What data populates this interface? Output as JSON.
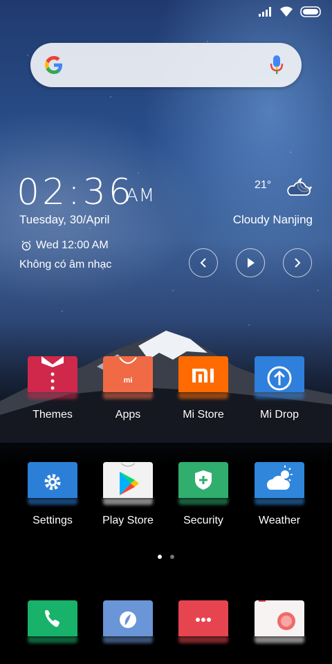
{
  "clock": {
    "time": "02:36",
    "ampm": "AM",
    "date": "Tuesday, 30/April"
  },
  "alarm": {
    "label": "Wed 12:00 AM"
  },
  "music": {
    "status": "Không có âm nhạc"
  },
  "weather": {
    "temp": "21°",
    "city": "Cloudy Nanjing"
  },
  "apps_row1": [
    {
      "label": "Themes",
      "color": "#d0284a"
    },
    {
      "label": "Apps",
      "color": "#f06a45"
    },
    {
      "label": "Mi Store",
      "color": "#ff6b00"
    },
    {
      "label": "Mi Drop",
      "color": "#2f7fdc"
    }
  ],
  "apps_row2": [
    {
      "label": "Settings",
      "color": "#2b7fd6"
    },
    {
      "label": "Play Store",
      "color": "#f2f2f2"
    },
    {
      "label": "Security",
      "color": "#2fae6e"
    },
    {
      "label": "Weather",
      "color": "#2f86da"
    }
  ],
  "dock": [
    {
      "name": "phone",
      "color": "#18b26a"
    },
    {
      "name": "browser",
      "color": "#6a95d6"
    },
    {
      "name": "messaging",
      "color": "#e6454f"
    },
    {
      "name": "camera",
      "color": "#f7f3f3"
    }
  ],
  "pages": {
    "count": 2,
    "active": 0
  }
}
